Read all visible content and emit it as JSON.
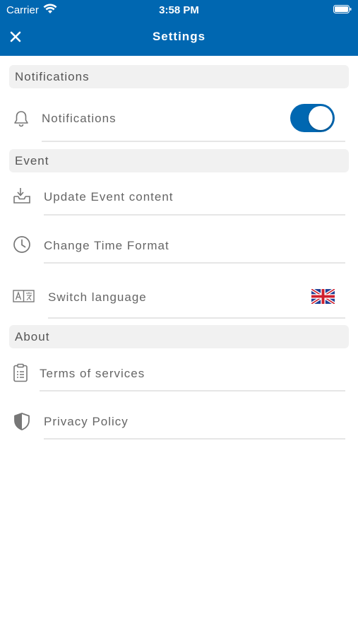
{
  "status_bar": {
    "carrier": "Carrier",
    "time": "3:58 PM"
  },
  "header": {
    "title": "Settings",
    "close_icon": "close-icon",
    "background_color": "#0067b1"
  },
  "sections": {
    "notifications": {
      "title": "Notifications",
      "items": [
        {
          "label": "Notifications",
          "icon": "bell-icon",
          "toggle_on": true
        }
      ]
    },
    "event": {
      "title": "Event",
      "items": [
        {
          "label": "Update Event content",
          "icon": "download-tray-icon"
        },
        {
          "label": "Change Time Format",
          "icon": "clock-icon"
        },
        {
          "label": "Switch language",
          "icon": "translate-icon",
          "value_icon": "uk-flag-icon"
        }
      ]
    },
    "about": {
      "title": "About",
      "items": [
        {
          "label": "Terms of services",
          "icon": "clipboard-icon"
        },
        {
          "label": "Privacy Policy",
          "icon": "shield-icon"
        }
      ]
    }
  },
  "colors": {
    "accent": "#0067b1",
    "section_bg": "#f1f1f1",
    "text": "#666666",
    "divider": "#e6e6e6"
  }
}
